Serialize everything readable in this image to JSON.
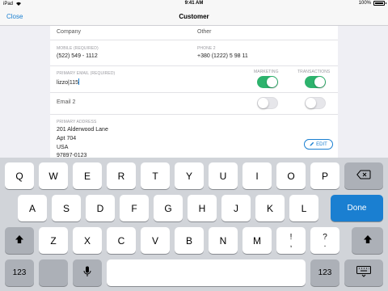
{
  "status_bar": {
    "carrier": "iPad",
    "time": "9:41 AM",
    "battery": "100%",
    "battery_level": 1.0
  },
  "nav": {
    "close_label": "Close",
    "title": "Customer"
  },
  "form": {
    "company": {
      "label": "Company"
    },
    "other": {
      "label": "Other"
    },
    "mobile": {
      "label": "MOBILE (REQUIRED)",
      "value": "(522) 549 - 1112"
    },
    "phone2": {
      "label": "PHONE 2",
      "value": "+380 (1222) 5 98 11"
    },
    "primary_email": {
      "label": "PRIMARY EMAIL (REQUIRED)",
      "value": "lizzo|115"
    },
    "marketing_label": "MARKETING",
    "transactions_label": "TRANSACTIONS",
    "primary_email_marketing": true,
    "primary_email_transactions": true,
    "email2": {
      "label": "Email 2"
    },
    "email2_marketing": false,
    "email2_transactions": false,
    "address": {
      "label": "PRIMARY ADDRESS",
      "line1": "201 Alderwood Lane",
      "line2": "Apt 704",
      "line3": "USA",
      "line4": "97897-0123"
    },
    "edit_label": "EDIT"
  },
  "keyboard": {
    "row1": [
      "Q",
      "W",
      "E",
      "R",
      "T",
      "Y",
      "U",
      "I",
      "O",
      "P"
    ],
    "row2": [
      "A",
      "S",
      "D",
      "F",
      "G",
      "H",
      "J",
      "K",
      "L"
    ],
    "row3": [
      "Z",
      "X",
      "C",
      "V",
      "B",
      "N",
      "M"
    ],
    "punct1": [
      "!",
      ","
    ],
    "punct2": [
      "?",
      "."
    ],
    "done_label": "Done",
    "numbers_label": "123",
    "icons": [
      "delete-icon",
      "shift-icon",
      "microphone-icon",
      "keyboard-dismiss-icon",
      "wifi-icon",
      "signal-icon"
    ]
  },
  "colors": {
    "accent": "#1a7fd1",
    "toggle_on": "#2db36d"
  }
}
